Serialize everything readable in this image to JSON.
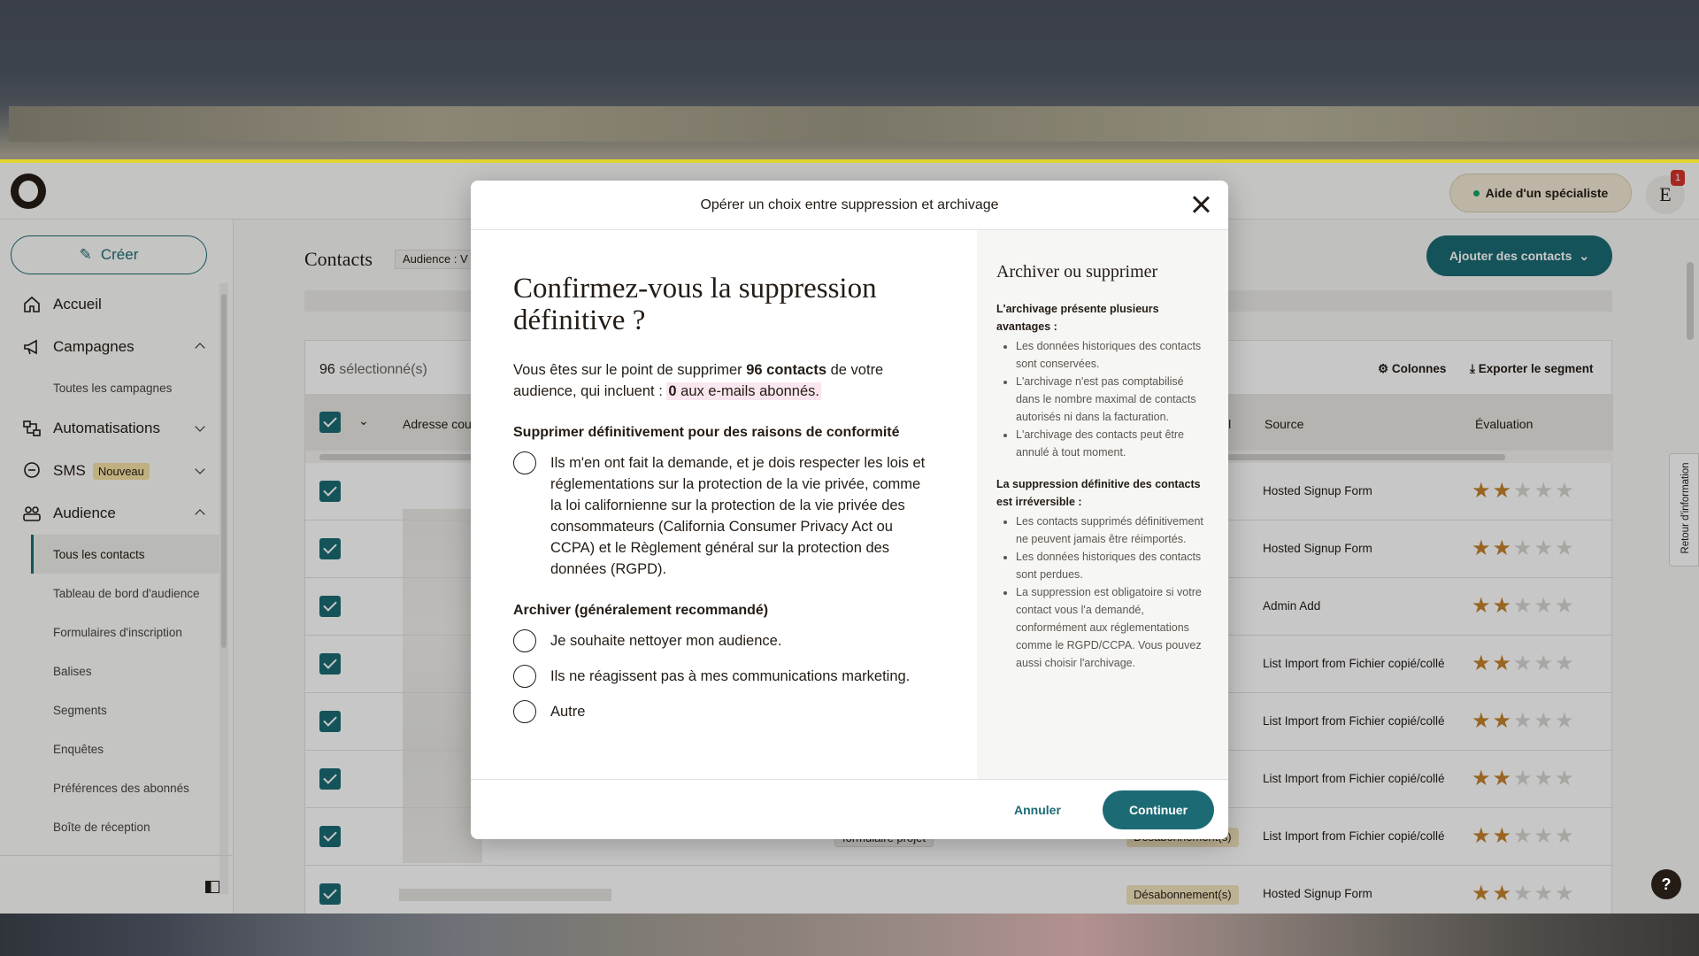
{
  "header": {
    "help_label": "Aide d'un spécialiste",
    "avatar_initial": "E",
    "notification_count": "1"
  },
  "sidebar": {
    "create_label": "Créer",
    "items": [
      {
        "label": "Accueil"
      },
      {
        "label": "Campagnes"
      },
      {
        "label": "Toutes les campagnes"
      },
      {
        "label": "Automatisations"
      },
      {
        "label": "SMS",
        "badge": "Nouveau"
      },
      {
        "label": "Audience"
      },
      {
        "label": "Tous les contacts"
      },
      {
        "label": "Tableau de bord d'audience"
      },
      {
        "label": "Formulaires d'inscription"
      },
      {
        "label": "Balises"
      },
      {
        "label": "Segments"
      },
      {
        "label": "Enquêtes"
      },
      {
        "label": "Préférences des abonnés"
      },
      {
        "label": "Boîte de réception"
      }
    ]
  },
  "main": {
    "title": "Contacts",
    "audience_chip": "Audience : V",
    "add_contacts_label": "Ajouter des contacts",
    "selected_count": "96",
    "selected_suffix": "sélectionné(s)",
    "columns_label": "Colonnes",
    "export_label": "Exporter le segment",
    "headers": {
      "email": "Adresse cou",
      "email_partial": "il",
      "source": "Source",
      "rating": "Évaluation"
    },
    "rows": [
      {
        "source": "Hosted Signup Form",
        "stars": 2
      },
      {
        "source": "Hosted Signup Form",
        "stars": 2
      },
      {
        "source": "Admin Add",
        "stars": 2
      },
      {
        "source": "List Import from Fichier copié/collé",
        "stars": 2
      },
      {
        "source": "List Import from Fichier copié/collé",
        "stars": 2
      },
      {
        "source": "List Import from Fichier copié/collé",
        "stars": 2
      },
      {
        "source": "List Import from Fichier copié/collé",
        "stars": 2,
        "tag": "formulaire projet",
        "status": "Désabonnement(s)"
      },
      {
        "source": "Hosted Signup Form",
        "stars": 2,
        "status": "Désabonnement(s)"
      }
    ],
    "feedback_label": "Retour d'information",
    "help_label": "?"
  },
  "modal": {
    "header": "Opérer un choix entre suppression et archivage",
    "title": "Confirmez-vous la suppression définitive ?",
    "desc_1": "Vous êtes sur le point de supprimer ",
    "desc_count": "96 contacts",
    "desc_2": " de votre audience, qui incluent : ",
    "desc_zero": "0",
    "desc_3": " aux e-mails abonnés.",
    "section_delete": "Supprimer définitivement pour des raisons de conformité",
    "option_compliance": "Ils m'en ont fait la demande, et je dois respecter les lois et réglementations sur la protection de la vie privée, comme la loi californienne sur la protection de la vie privée des consommateurs (California Consumer Privacy Act ou CCPA) et le Règlement général sur la protection des données (RGPD).",
    "section_archive": "Archiver (généralement recommandé)",
    "option_clean": "Je souhaite nettoyer mon audience.",
    "option_inactive": "Ils ne réagissent pas à mes communications marketing.",
    "option_other": "Autre",
    "right_title": "Archiver ou supprimer",
    "archive_head": "L'archivage présente plusieurs avantages :",
    "archive_points": [
      "Les données historiques des contacts sont conservées.",
      "L'archivage n'est pas comptabilisé dans le nombre maximal de contacts autorisés ni dans la facturation.",
      "L'archivage des contacts peut être annulé à tout moment."
    ],
    "delete_head": "La suppression définitive des contacts est irréversible :",
    "delete_points": [
      "Les contacts supprimés définitivement ne peuvent jamais être réimportés.",
      "Les données historiques des contacts sont perdues.",
      "La suppression est obligatoire si votre contact vous l'a demandé, conformément aux réglementations comme le RGPD/CCPA. Vous pouvez aussi choisir l'archivage."
    ],
    "cancel_label": "Annuler",
    "continue_label": "Continuer"
  },
  "colors": {
    "brand": "#1c6b74",
    "star": "#c4822c",
    "unsub_tag": "#f2e3bd"
  }
}
